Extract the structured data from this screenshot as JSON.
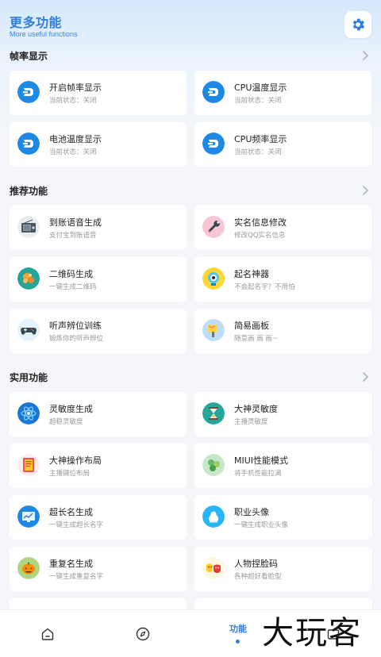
{
  "header": {
    "title": "更多功能",
    "subtitle": "More useful functions",
    "settings_icon": "gear-icon"
  },
  "sections": [
    {
      "title": "帧率显示",
      "cards": [
        {
          "title": "开启帧率显示",
          "subtitle": "当前状态：关闭",
          "icon": "dash-icon"
        },
        {
          "title": "CPU温度显示",
          "subtitle": "当前状态：关闭",
          "icon": "dash-icon"
        },
        {
          "title": "电池温度显示",
          "subtitle": "当前状态：关闭",
          "icon": "dash-icon"
        },
        {
          "title": "CPU频率显示",
          "subtitle": "当前状态：关闭",
          "icon": "dash-icon"
        }
      ]
    },
    {
      "title": "推荐功能",
      "cards": [
        {
          "title": "到账语音生成",
          "subtitle": "支付宝到账语音",
          "icon": "radio-icon"
        },
        {
          "title": "实名信息修改",
          "subtitle": "修改QQ实名信息",
          "icon": "wrench-icon"
        },
        {
          "title": "二维码生成",
          "subtitle": "一键生成二维码",
          "icon": "qrcode-icon"
        },
        {
          "title": "起名神器",
          "subtitle": "不会起名字？不用怕",
          "icon": "robot-icon"
        },
        {
          "title": "听声辨位训练",
          "subtitle": "锻炼你的听声辨位",
          "icon": "gamepad-icon"
        },
        {
          "title": "简易画板",
          "subtitle": "随意画 画 画~",
          "icon": "paint-icon"
        }
      ]
    },
    {
      "title": "实用功能",
      "cards": [
        {
          "title": "灵敏度生成",
          "subtitle": "超稳灵敏度",
          "icon": "atom-icon"
        },
        {
          "title": "大神灵敏度",
          "subtitle": "主播灵敏度",
          "icon": "hourglass-icon"
        },
        {
          "title": "大神操作布局",
          "subtitle": "主播键位布局",
          "icon": "layout-icon"
        },
        {
          "title": "MIUI性能模式",
          "subtitle": "将手机性能拉满",
          "icon": "performance-icon"
        },
        {
          "title": "超长名生成",
          "subtitle": "一键生成超长名字",
          "icon": "monitor-icon"
        },
        {
          "title": "职业头像",
          "subtitle": "一键生成职业头像",
          "icon": "avatar-icon"
        },
        {
          "title": "重复名生成",
          "subtitle": "一键生成重复名字",
          "icon": "pumpkin-icon"
        },
        {
          "title": "人物捏脸码",
          "subtitle": "各种超好看脸型",
          "icon": "mask-icon"
        }
      ]
    }
  ],
  "tabbar": {
    "tabs": [
      {
        "icon": "home-icon"
      },
      {
        "icon": "compass-icon"
      },
      {
        "label": "功能",
        "active": true
      },
      {
        "icon": "window-icon"
      }
    ]
  },
  "watermark": "大玩客",
  "colors": {
    "accent": "#2f7de0",
    "dash_icon_bg": "#1e88e5",
    "background": "#f4f6fa"
  }
}
